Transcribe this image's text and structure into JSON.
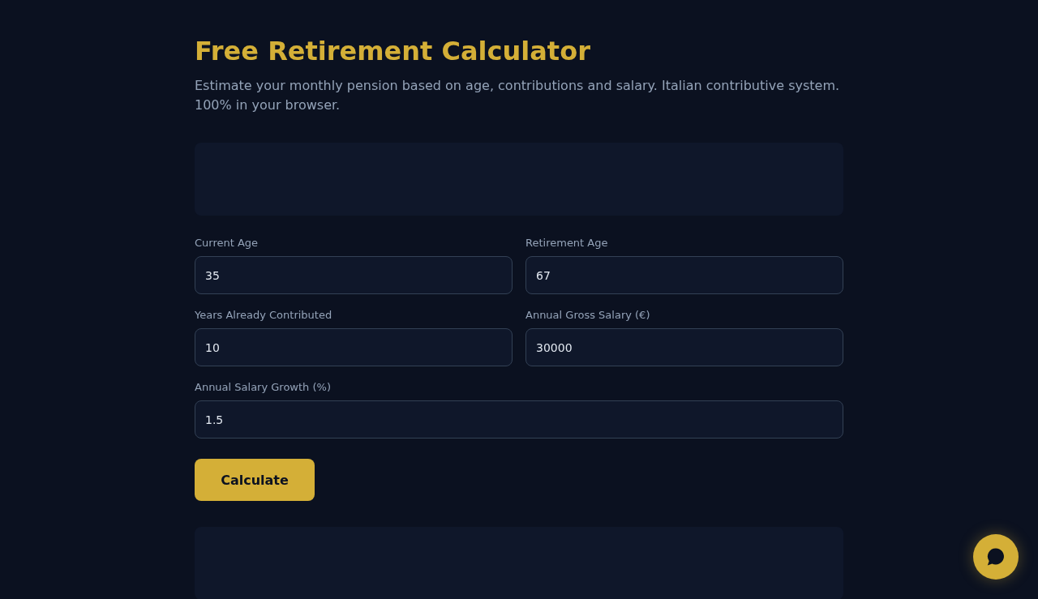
{
  "title": "Free Retirement Calculator",
  "subtitle": "Estimate your monthly pension based on age, contributions and salary. Italian contributive system. 100% in your browser.",
  "form_rows": [
    {
      "fields": [
        {
          "label": "Current Age",
          "value": "35"
        },
        {
          "label": "Retirement Age",
          "value": "67"
        }
      ]
    },
    {
      "fields": [
        {
          "label": "Years Already Contributed",
          "value": "10"
        },
        {
          "label": "Annual Gross Salary (€)",
          "value": "30000"
        }
      ]
    },
    {
      "fields": [
        {
          "label": "Annual Salary Growth (%)",
          "value": "1.5"
        }
      ]
    }
  ],
  "button": {
    "label": "Calculate"
  }
}
